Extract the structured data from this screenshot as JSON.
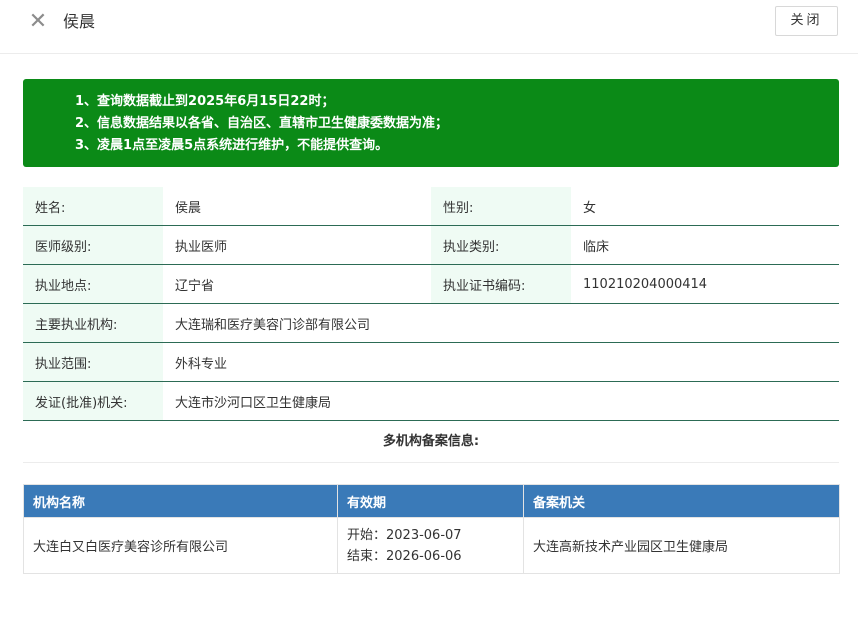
{
  "header": {
    "close_icon": "✕",
    "title": "侯晨",
    "close_label": "关闭"
  },
  "notice": {
    "lines": [
      "1、查询数据截止到2025年6月15日22时；",
      "2、信息数据结果以各省、自治区、直辖市卫生健康委数据为准；",
      "3、凌晨1点至凌晨5点系统进行维护，不能提供查询。"
    ],
    "bg_color": "#0b8a17"
  },
  "info": {
    "name_label": "姓名:",
    "name": "侯晨",
    "gender_label": "性别:",
    "gender": "女",
    "level_label": "医师级别:",
    "level": "执业医师",
    "category_label": "执业类别:",
    "category": "临床",
    "location_label": "执业地点:",
    "location": "辽宁省",
    "cert_label": "执业证书编码:",
    "cert": "110210204000414",
    "institution_label": "主要执业机构:",
    "institution": "大连瑞和医疗美容门诊部有限公司",
    "scope_label": "执业范围:",
    "scope": "外科专业",
    "issuer_label": "发证(批准)机关:",
    "issuer": "大连市沙河口区卫生健康局"
  },
  "multi": {
    "title": "多机构备案信息:",
    "columns": [
      "机构名称",
      "有效期",
      "备案机关"
    ],
    "rows": [
      {
        "name": "大连白又白医疗美容诊所有限公司",
        "start": "开始：2023-06-07",
        "end": "结束：2026-06-06",
        "authority": "大连高新技术产业园区卫生健康局"
      }
    ],
    "header_color": "#3a7ab8"
  }
}
